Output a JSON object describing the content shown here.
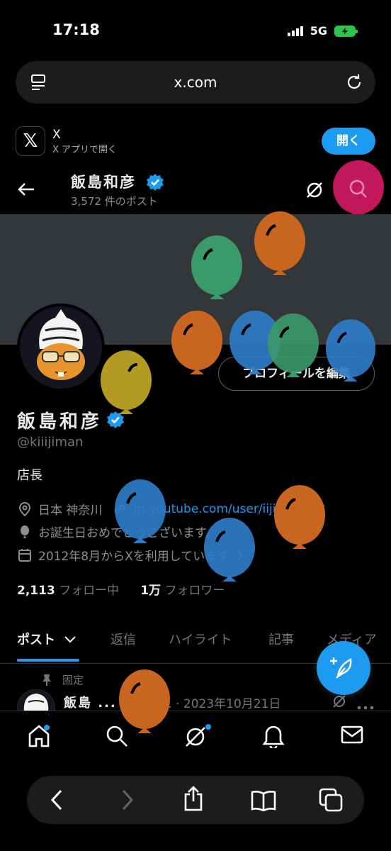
{
  "status_bar": {
    "time": "17:18",
    "network": "5G"
  },
  "browser": {
    "url": "x.com"
  },
  "app_banner": {
    "logo": "𝕏",
    "app_name": "X",
    "subtitle": "X アプリで開く",
    "open_label": "開く"
  },
  "header": {
    "name": "飯島和彦",
    "post_count": "3,572 件のポスト"
  },
  "profile": {
    "name": "飯島和彦",
    "handle": "@kiiijiman",
    "bio": "店長",
    "edit_label": "プロフィールを編集",
    "location": "日本 神奈川",
    "website": "m.youtube.com/user/iijiman333",
    "birthday": "お誕生日おめでとうございます。",
    "joined": "2012年8月からXを利用しています",
    "following_count": "2,113",
    "following_label": "フォロー中",
    "followers_count": "1万",
    "followers_label": "フォロワー"
  },
  "tabs": [
    {
      "label": "ポスト"
    },
    {
      "label": "返信"
    },
    {
      "label": "ハイライト"
    },
    {
      "label": "記事"
    },
    {
      "label": "メディア"
    }
  ],
  "pinned_post": {
    "pinned_label": "固定",
    "author": "飯島 ...",
    "meta": "@kiiiji... · 2023年10月21日"
  },
  "colors": {
    "accent": "#1d9bf0",
    "background": "#000000",
    "balloon_green": "#3a9a6a",
    "balloon_orange": "#c8651e",
    "balloon_blue": "#2e7cc8",
    "balloon_yellow": "#b39a22",
    "balloon_pink": "#c2185b"
  },
  "icons": {
    "url_left": "reader-icon",
    "url_right": "reload-icon",
    "back": "back-arrow-icon",
    "grok": "grok-icon",
    "search": "search-icon",
    "compose": "compose-icon",
    "nav": [
      "home-icon",
      "search-icon",
      "grok-icon",
      "bell-icon",
      "mail-icon"
    ],
    "toolbar": [
      "back-icon",
      "forward-icon",
      "share-icon",
      "bookmarks-icon",
      "tabs-icon"
    ]
  }
}
